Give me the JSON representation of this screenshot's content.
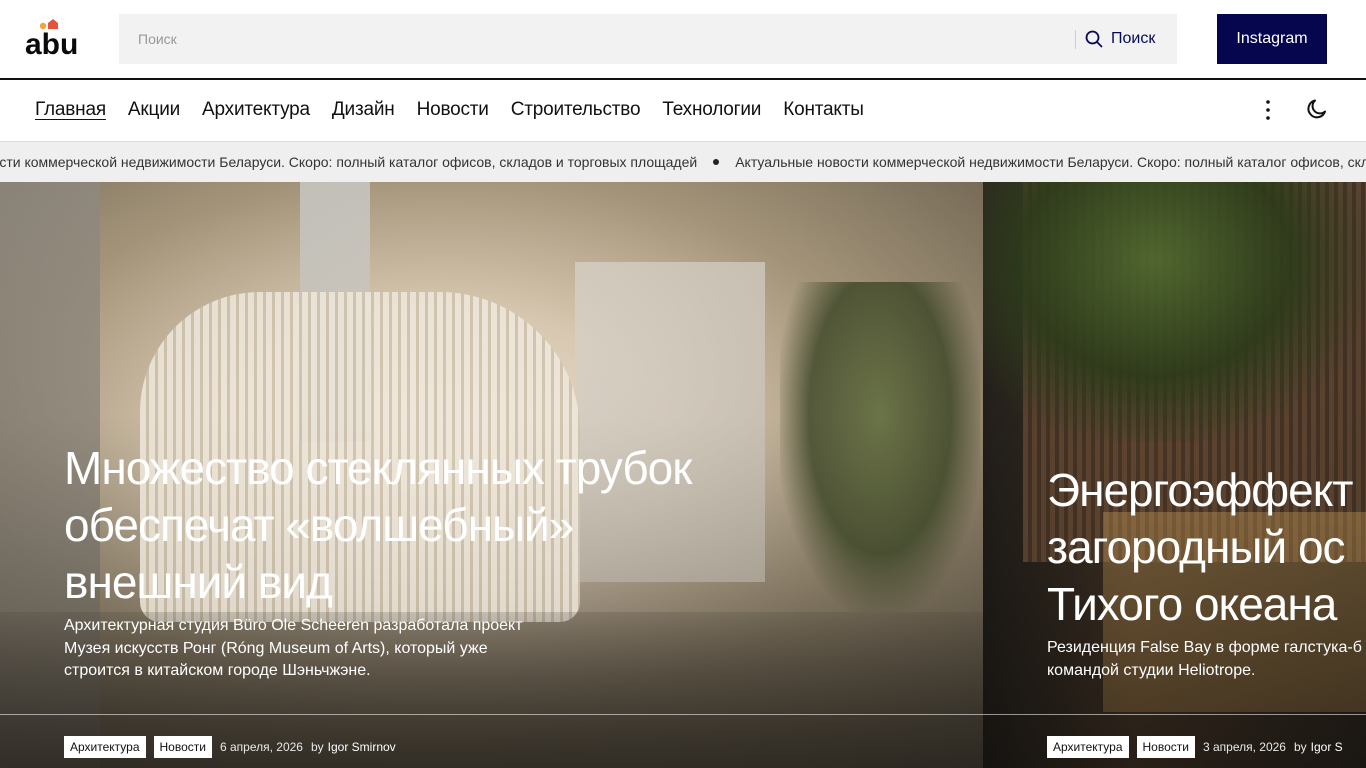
{
  "header": {
    "logo_text": "abu",
    "search": {
      "placeholder": "Поиск",
      "button_label": "Поиск"
    },
    "instagram_label": "Instagram"
  },
  "nav": {
    "items": [
      {
        "label": "Главная",
        "active": true
      },
      {
        "label": "Акции"
      },
      {
        "label": "Архитектура"
      },
      {
        "label": "Дизайн"
      },
      {
        "label": "Новости"
      },
      {
        "label": "Строительство"
      },
      {
        "label": "Технологии"
      },
      {
        "label": "Контакты"
      }
    ]
  },
  "ticker": {
    "text": "Актуальные новости коммерческой недвижимости Беларуси. Скоро: полный каталог офисов, складов и торговых площадей"
  },
  "articles": [
    {
      "title_line1": "Множество стеклянных трубок",
      "title_line2": "обеспечат «волшебный»",
      "title_line3": "внешний вид",
      "desc_line1": "Архитектурная студия Büro Ole Scheeren разработала проект",
      "desc_line2": "Музея искусств Ронг (Róng Museum of Arts), который уже",
      "desc_line3": "строится в китайском городе Шэньчжэне.",
      "tags": [
        "Архитектура",
        "Новости"
      ],
      "date": "6 апреля, 2026",
      "by": "by",
      "author": "Igor Smirnov"
    },
    {
      "title_line1": "Энергоэффект",
      "title_line2": "загородный ос",
      "title_line3": "Тихого океана",
      "desc_line1": "Резиденция False Bay в форме галстука-б",
      "desc_line2": "командой студии Heliotrope.",
      "tags": [
        "Архитектура",
        "Новости"
      ],
      "date": "3 апреля, 2026",
      "by": "by",
      "author": "Igor S"
    }
  ],
  "colors": {
    "accent": "#06064f",
    "logo_orange": "#f2a33a",
    "logo_red": "#e5533d"
  }
}
